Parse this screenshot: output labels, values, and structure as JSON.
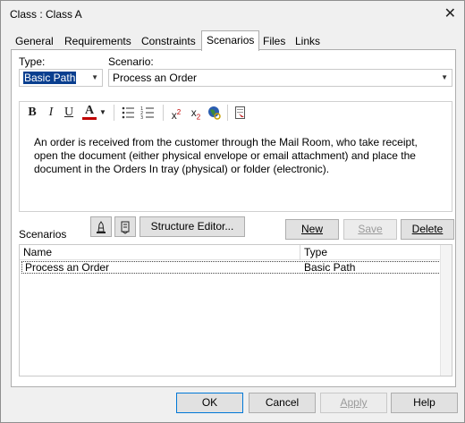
{
  "window": {
    "title": "Class : Class A",
    "close_glyph": "✕"
  },
  "tabs": [
    {
      "label": "General",
      "active": false
    },
    {
      "label": "Requirements",
      "active": false
    },
    {
      "label": "Constraints",
      "active": false
    },
    {
      "label": "Scenarios",
      "active": true
    },
    {
      "label": "Files",
      "active": false
    },
    {
      "label": "Links",
      "active": false
    }
  ],
  "form": {
    "type_label": "Type:",
    "type_value": "Basic Path",
    "scenario_label": "Scenario:",
    "scenario_value": "Process an Order"
  },
  "toolbar": {
    "bold": "B",
    "italic": "I",
    "underline": "U",
    "font_color": "A",
    "superscript_base": "x",
    "superscript": "2",
    "subscript_base": "x",
    "subscript": "2"
  },
  "editor": {
    "text": "An order is received from the customer through the Mail Room, who take receipt, open the document (either physical envelope or email attachment) and place the document in the Orders In tray (physical) or folder (electronic)."
  },
  "scenarios": {
    "label": "Scenarios",
    "structure_editor_label": "Structure Editor...",
    "new_label": "New",
    "save_label": "Save",
    "delete_label": "Delete",
    "columns": [
      "Name",
      "Type"
    ],
    "rows": [
      {
        "name": "Process an Order",
        "type": "Basic Path"
      }
    ]
  },
  "footer": {
    "ok": "OK",
    "cancel": "Cancel",
    "apply": "Apply",
    "help": "Help"
  },
  "colors": {
    "selection": "#0a3f8f",
    "accent": "#0078d7"
  }
}
